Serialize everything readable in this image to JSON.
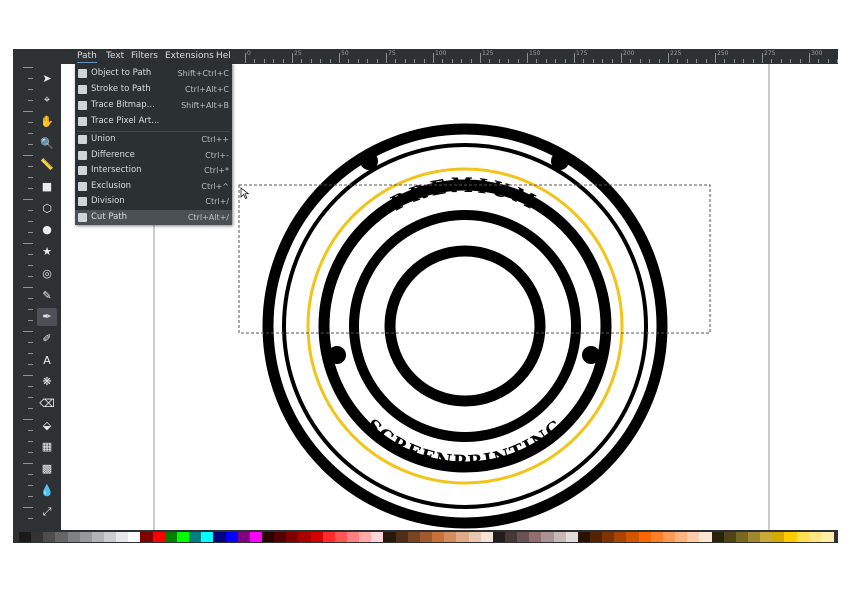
{
  "menubar": {
    "items": [
      "Path",
      "Text",
      "Filters",
      "Extensions",
      "Hel"
    ]
  },
  "path_menu": {
    "items": [
      {
        "label": "Object to Path",
        "shortcut": "Shift+Ctrl+C",
        "icon": "object-to-path-icon"
      },
      {
        "label": "Stroke to Path",
        "shortcut": "Ctrl+Alt+C",
        "icon": "stroke-to-path-icon"
      },
      {
        "label": "Trace Bitmap...",
        "shortcut": "Shift+Alt+B",
        "icon": "trace-bitmap-icon"
      },
      {
        "label": "Trace Pixel Art...",
        "shortcut": "",
        "icon": "trace-pixel-art-icon"
      },
      {
        "label": "Union",
        "shortcut": "Ctrl++",
        "icon": "union-icon"
      },
      {
        "label": "Difference",
        "shortcut": "Ctrl+-",
        "icon": "difference-icon"
      },
      {
        "label": "Intersection",
        "shortcut": "Ctrl+*",
        "icon": "intersection-icon"
      },
      {
        "label": "Exclusion",
        "shortcut": "Ctrl+^",
        "icon": "exclusion-icon"
      },
      {
        "label": "Division",
        "shortcut": "Ctrl+/",
        "icon": "division-icon"
      },
      {
        "label": "Cut Path",
        "shortcut": "Ctrl+Alt+/",
        "icon": "cut-path-icon"
      }
    ],
    "highlighted": "Cut Path"
  },
  "ruler": {
    "labels": [
      "0",
      "25",
      "50",
      "75",
      "100",
      "125",
      "150",
      "175",
      "200",
      "225",
      "250",
      "275",
      "300",
      "325"
    ]
  },
  "canvas": {
    "top_text": "PREMIUM",
    "bottom_text": "SCREENPRINTING",
    "colors": {
      "stroke": "#000000",
      "accent": "#f2c418",
      "selection": "#555555"
    }
  },
  "tools": [
    "selector-tool-icon",
    "node-tool-icon",
    "tweak-tool-icon",
    "zoom-tool-icon",
    "measure-tool-icon",
    "rectangle-tool-icon",
    "3dbox-tool-icon",
    "ellipse-tool-icon",
    "star-tool-icon",
    "spiral-tool-icon",
    "pencil-tool-icon",
    "pen-tool-icon",
    "calligraphy-tool-icon",
    "text-tool-icon",
    "spray-tool-icon",
    "eraser-tool-icon",
    "paint-bucket-tool-icon",
    "gradient-tool-icon",
    "mesh-tool-icon",
    "dropper-tool-icon",
    "connector-tool-icon"
  ],
  "palette_colors": [
    "#1a1a1a",
    "#333333",
    "#4d4d4d",
    "#666666",
    "#808080",
    "#999999",
    "#b3b3b3",
    "#cccccc",
    "#e6e6e6",
    "#ffffff",
    "#800000",
    "#ff0000",
    "#008000",
    "#00ff00",
    "#008080",
    "#00ffff",
    "#000080",
    "#0000ff",
    "#800080",
    "#ff00ff",
    "#2b0000",
    "#550000",
    "#800000",
    "#aa0000",
    "#d40000",
    "#ff2a2a",
    "#ff5555",
    "#ff8080",
    "#ffaaaa",
    "#ffd5d5",
    "#28170b",
    "#502d16",
    "#784421",
    "#a05a2c",
    "#c87137",
    "#d38d5f",
    "#deaa87",
    "#e9c6af",
    "#f4e3d7",
    "#241c1c",
    "#483737",
    "#6c5353",
    "#916f6f",
    "#ac9393",
    "#c8b7b7",
    "#e3dbdb",
    "#2b1100",
    "#552200",
    "#803300",
    "#aa4400",
    "#d45500",
    "#ff6600",
    "#ff7f2a",
    "#ff9955",
    "#ffb380",
    "#ffccaa",
    "#ffe6d5",
    "#28220b",
    "#504416",
    "#786721",
    "#a0892c",
    "#c8ab37",
    "#d4aa00",
    "#ffcc00",
    "#ffdd55",
    "#ffe680",
    "#ffeeaa"
  ]
}
